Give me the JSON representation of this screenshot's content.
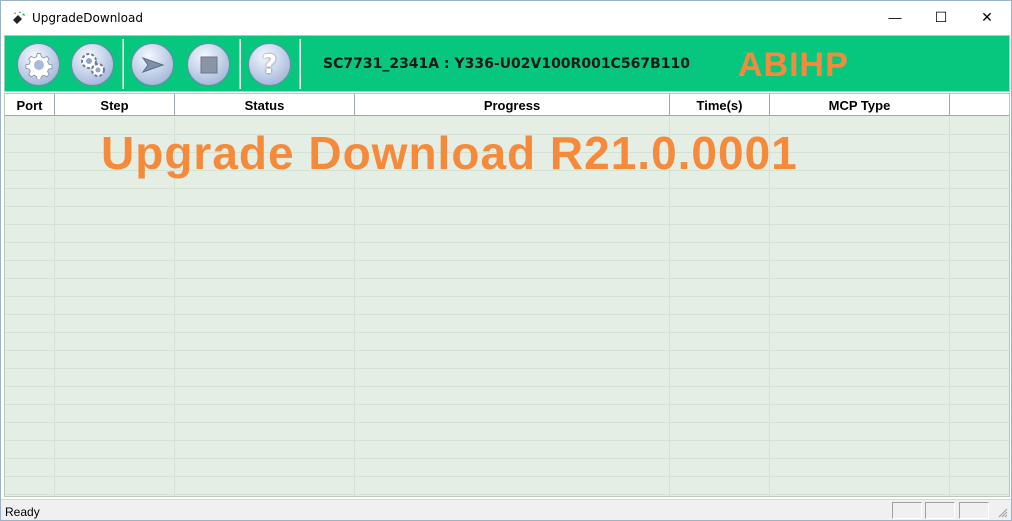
{
  "window": {
    "title": "UpgradeDownload",
    "icons": {
      "app": "upgrade-download-app-icon",
      "minimize": "minimize-icon",
      "maximize": "maximize-icon",
      "close": "close-icon"
    },
    "controls": {
      "minimize": "—",
      "maximize": "☐",
      "close": "✕"
    }
  },
  "toolbar": {
    "buttons": [
      {
        "name": "load-packet-button",
        "icon": "gear-icon"
      },
      {
        "name": "settings-button",
        "icon": "gears-icon"
      },
      {
        "name": "start-download-button",
        "icon": "play-arrow-icon"
      },
      {
        "name": "stop-download-button",
        "icon": "stop-square-icon"
      },
      {
        "name": "help-button",
        "icon": "question-icon",
        "label": "?"
      }
    ],
    "info": "SC7731_2341A : Y336-U02V100R001C567B110",
    "brand": "ABIHP",
    "colors": {
      "background": "#07c77f",
      "brand": "#f58a3a"
    }
  },
  "list": {
    "columns": [
      "Port",
      "Step",
      "Status",
      "Progress",
      "Time(s)",
      "MCP Type",
      ""
    ],
    "rows": [],
    "watermark": "Upgrade Download R21.0.0001"
  },
  "statusbar": {
    "text": "Ready"
  }
}
